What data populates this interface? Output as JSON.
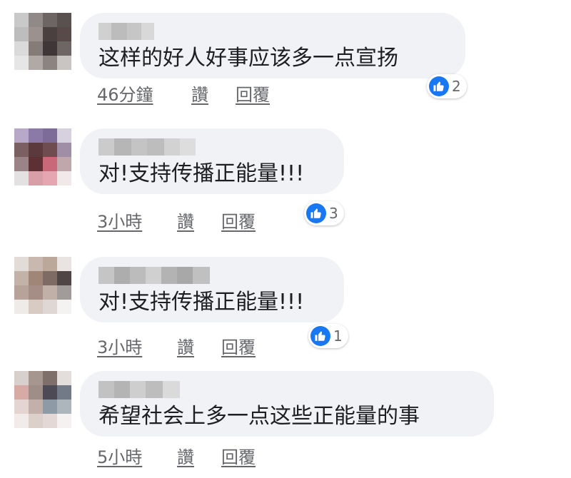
{
  "colors": {
    "bubble": "#f0f2f5",
    "text": "#1c1e21",
    "meta": "#65676b",
    "like": "#1877f2"
  },
  "comments": [
    {
      "text": "这样的好人好事应该多一点宣扬",
      "time": "46分鐘",
      "like_label": "讚",
      "reply_label": "回覆",
      "reaction_icon": "thumbs-up-icon",
      "reaction_count": "2"
    },
    {
      "text": "对!支持传播正能量!!!",
      "time": "3小時",
      "like_label": "讚",
      "reply_label": "回覆",
      "reaction_icon": "thumbs-up-icon",
      "reaction_count": "3"
    },
    {
      "text": "对!支持传播正能量!!!",
      "time": "3小時",
      "like_label": "讚",
      "reply_label": "回覆",
      "reaction_icon": "thumbs-up-icon",
      "reaction_count": "1"
    },
    {
      "text": "希望社会上多一点这些正能量的事",
      "time": "5小時",
      "like_label": "讚",
      "reply_label": "回覆"
    }
  ]
}
